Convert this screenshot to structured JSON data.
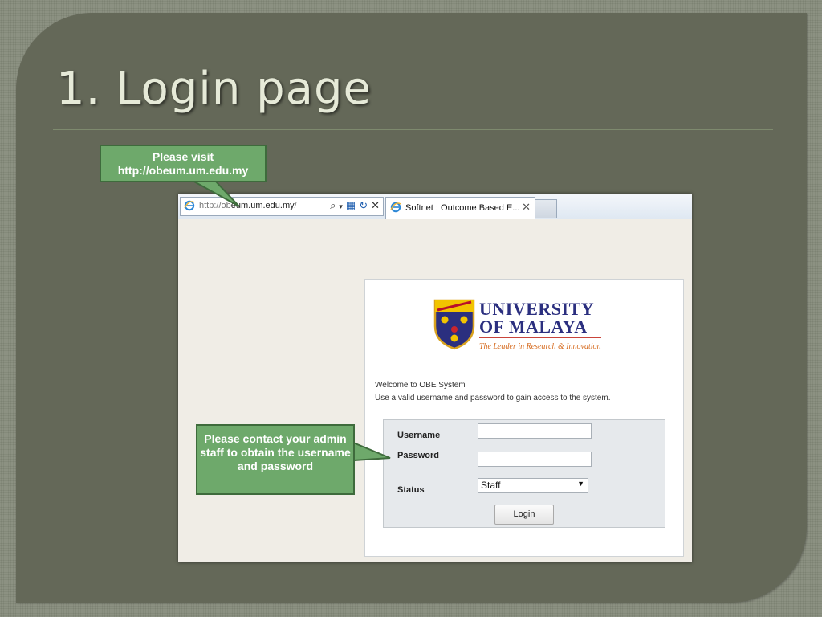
{
  "slide": {
    "title": "1. Login page"
  },
  "callouts": {
    "visit_line1": "Please visit",
    "visit_line2": "http://obeum.um.edu.my",
    "contact_text": "Please contact your admin staff to obtain the username and password"
  },
  "browser": {
    "address_prefix": "http://ob",
    "address_domain": "eum.um.edu.my",
    "address_suffix": "/",
    "tab_title": "Softnet : Outcome Based E...",
    "tab_close": "✕",
    "toolbar_icons": [
      "search-icon",
      "dropdown-icon",
      "compatibility-icon",
      "refresh-icon",
      "stop-icon"
    ]
  },
  "login": {
    "logo_line1": "UNIVERSITY",
    "logo_line2": "OF MALAYA",
    "logo_tagline": "The Leader in Research & Innovation",
    "welcome": "Welcome to OBE System",
    "instructions": "Use a valid username and password to gain access to the system.",
    "username_label": "Username",
    "username_value": "",
    "password_label": "Password",
    "password_value": "",
    "status_label": "Status",
    "status_selected": "Staff",
    "login_button": "Login"
  },
  "colors": {
    "slide_bg": "#646858",
    "title_text": "#e6ead8",
    "callout_fill": "#6ea96b",
    "callout_border": "#3e6b3c",
    "logo_blue": "#2b2f7f",
    "logo_orange": "#d66b1f"
  }
}
